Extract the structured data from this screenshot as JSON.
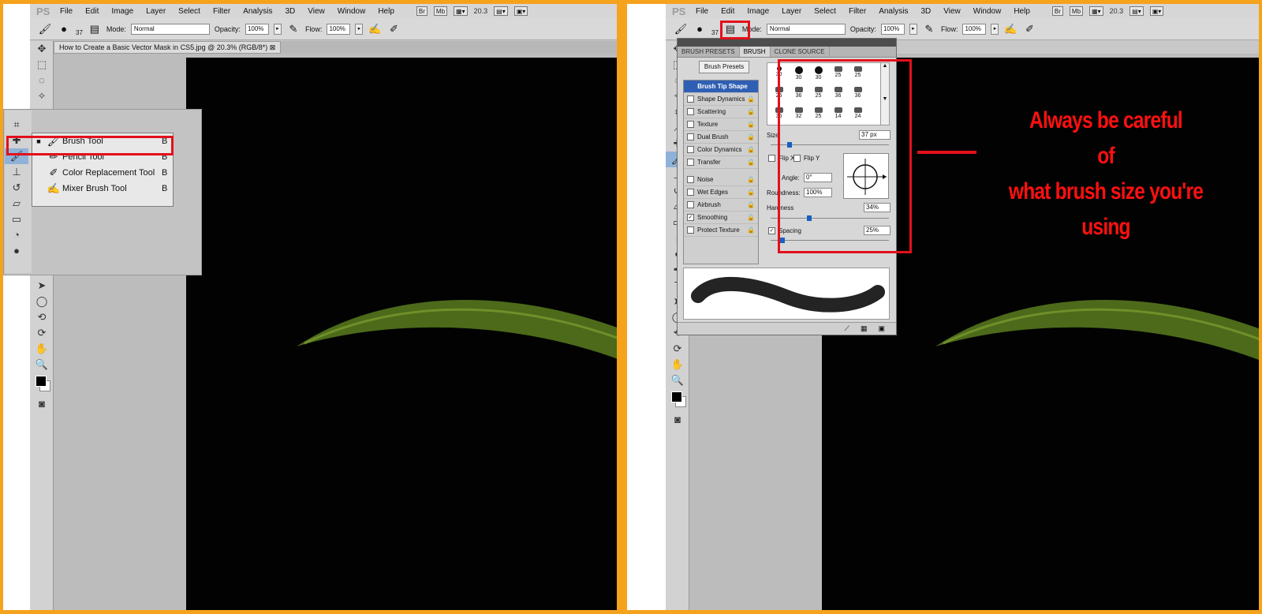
{
  "menu": {
    "logo": "PS",
    "items": [
      "File",
      "Edit",
      "Image",
      "Layer",
      "Select",
      "Filter",
      "Analysis",
      "3D",
      "View",
      "Window",
      "Help"
    ],
    "bridge": "Br",
    "minibridge": "Mb",
    "zoom": "20.3"
  },
  "options": {
    "brush_size": "37",
    "mode_label": "Mode:",
    "mode_value": "Normal",
    "opacity_label": "Opacity:",
    "opacity_value": "100%",
    "flow_label": "Flow:",
    "flow_value": "100%"
  },
  "document": {
    "tab_title": "How to Create a Basic Vector Mask in CS5.jpg @ 20.3% (RGB/8*)"
  },
  "flyout": {
    "items": [
      {
        "label": "Brush Tool",
        "key": "B",
        "selected": true,
        "icon": "brush-icon"
      },
      {
        "label": "Pencil Tool",
        "key": "B",
        "selected": false,
        "icon": "pencil-icon"
      },
      {
        "label": "Color Replacement Tool",
        "key": "B",
        "selected": false,
        "icon": "color-replacement-icon"
      },
      {
        "label": "Mixer Brush Tool",
        "key": "B",
        "selected": false,
        "icon": "mixer-brush-icon"
      }
    ]
  },
  "brush_panel": {
    "tabs": [
      "BRUSH PRESETS",
      "BRUSH",
      "CLONE SOURCE"
    ],
    "active_tab": "BRUSH",
    "presets_button": "Brush Presets",
    "settings": [
      {
        "label": "Brush Tip Shape",
        "checkable": false,
        "checked": false
      },
      {
        "label": "Shape Dynamics",
        "checkable": true,
        "checked": false
      },
      {
        "label": "Scattering",
        "checkable": true,
        "checked": false
      },
      {
        "label": "Texture",
        "checkable": true,
        "checked": false
      },
      {
        "label": "Dual Brush",
        "checkable": true,
        "checked": false
      },
      {
        "label": "Color Dynamics",
        "checkable": true,
        "checked": false
      },
      {
        "label": "Transfer",
        "checkable": true,
        "checked": false
      },
      {
        "label": "Noise",
        "checkable": true,
        "checked": false
      },
      {
        "label": "Wet Edges",
        "checkable": true,
        "checked": false
      },
      {
        "label": "Airbrush",
        "checkable": true,
        "checked": false
      },
      {
        "label": "Smoothing",
        "checkable": true,
        "checked": true
      },
      {
        "label": "Protect Texture",
        "checkable": true,
        "checked": false
      }
    ],
    "tip_sizes": [
      "30",
      "30",
      "30",
      "25",
      "25",
      "25",
      "36",
      "25",
      "36",
      "36",
      "36",
      "32",
      "25",
      "14",
      "24"
    ],
    "size_label": "Size",
    "size_value": "37 px",
    "flip_x": "Flip X",
    "flip_y": "Flip Y",
    "angle_label": "Angle:",
    "angle_value": "0°",
    "roundness_label": "Roundness:",
    "roundness_value": "100%",
    "hardness_label": "Hardness",
    "hardness_value": "34%",
    "spacing_label": "Spacing",
    "spacing_value": "25%"
  },
  "annotation": {
    "line1": "Always be careful",
    "line2": "of",
    "line3": "what brush size you're using"
  },
  "colors": {
    "frame": "#f5a21d",
    "highlight": "#e3101b",
    "annotation": "#ff1010",
    "selection": "#2f5fb4"
  }
}
